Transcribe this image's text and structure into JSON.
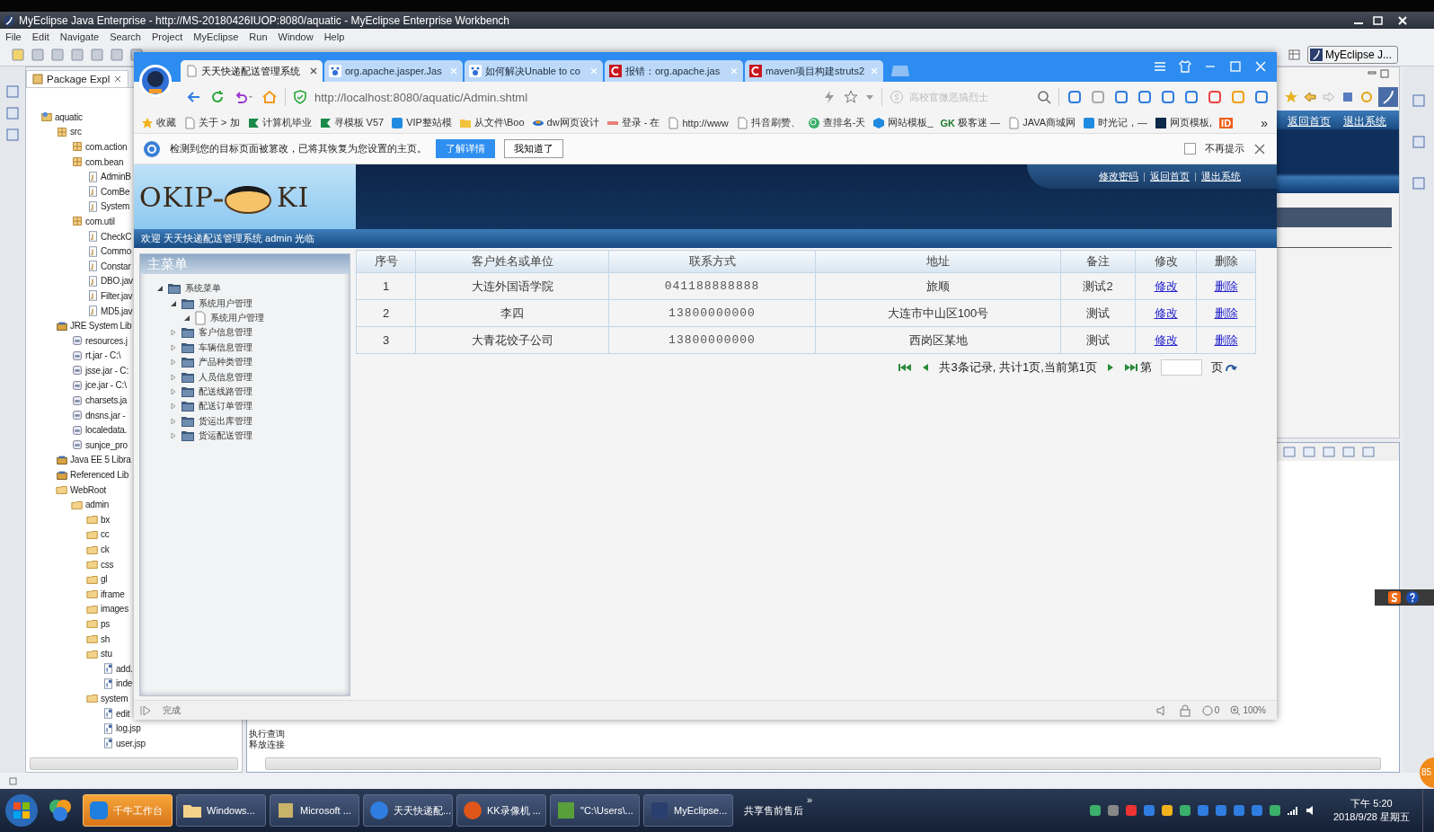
{
  "ide": {
    "title": "MyEclipse Java Enterprise - http://MS-20180426IUOP:8080/aquatic - MyEclipse Enterprise Workbench",
    "menu": [
      "File",
      "Edit",
      "Navigate",
      "Search",
      "Project",
      "MyEclipse",
      "Run",
      "Window",
      "Help"
    ],
    "perspective": "MyEclipse J...",
    "explorer": {
      "tab": "Package Expl",
      "tree": [
        {
          "label": "aquatic",
          "kind": "project",
          "children": [
            {
              "label": "src",
              "kind": "src",
              "children": [
                {
                  "label": "com.action",
                  "kind": "package"
                },
                {
                  "label": "com.bean",
                  "kind": "package",
                  "children": [
                    {
                      "label": "AdminB",
                      "kind": "java"
                    },
                    {
                      "label": "ComBe",
                      "kind": "java"
                    },
                    {
                      "label": "System",
                      "kind": "java"
                    }
                  ]
                },
                {
                  "label": "com.util",
                  "kind": "package",
                  "children": [
                    {
                      "label": "CheckC",
                      "kind": "java"
                    },
                    {
                      "label": "Commo",
                      "kind": "java"
                    },
                    {
                      "label": "Constar",
                      "kind": "java"
                    },
                    {
                      "label": "DBO.jav",
                      "kind": "java"
                    },
                    {
                      "label": "Filter.jav",
                      "kind": "java"
                    },
                    {
                      "label": "MD5.jav",
                      "kind": "java"
                    }
                  ]
                }
              ]
            },
            {
              "label": "JRE System Lib",
              "kind": "lib",
              "children": [
                {
                  "label": "resources.j",
                  "kind": "jar"
                },
                {
                  "label": "rt.jar - C:\\",
                  "kind": "jar"
                },
                {
                  "label": "jsse.jar - C:",
                  "kind": "jar"
                },
                {
                  "label": "jce.jar - C:\\",
                  "kind": "jar"
                },
                {
                  "label": "charsets.ja",
                  "kind": "jar"
                },
                {
                  "label": "dnsns.jar -",
                  "kind": "jar"
                },
                {
                  "label": "localedata.",
                  "kind": "jar"
                },
                {
                  "label": "sunjce_pro",
                  "kind": "jar"
                }
              ]
            },
            {
              "label": "Java EE 5 Libra",
              "kind": "lib"
            },
            {
              "label": "Referenced Lib",
              "kind": "lib"
            },
            {
              "label": "WebRoot",
              "kind": "folder",
              "children": [
                {
                  "label": "admin",
                  "kind": "folder",
                  "children": [
                    {
                      "label": "bx",
                      "kind": "folder"
                    },
                    {
                      "label": "cc",
                      "kind": "folder"
                    },
                    {
                      "label": "ck",
                      "kind": "folder"
                    },
                    {
                      "label": "css",
                      "kind": "folder"
                    },
                    {
                      "label": "gl",
                      "kind": "folder"
                    },
                    {
                      "label": "iframe",
                      "kind": "folder"
                    },
                    {
                      "label": "images",
                      "kind": "folder"
                    },
                    {
                      "label": "ps",
                      "kind": "folder"
                    },
                    {
                      "label": "sh",
                      "kind": "folder"
                    },
                    {
                      "label": "stu",
                      "kind": "folder",
                      "children": [
                        {
                          "label": "add.",
                          "kind": "jsp"
                        },
                        {
                          "label": "inde",
                          "kind": "jsp"
                        }
                      ]
                    },
                    {
                      "label": "system",
                      "kind": "folder",
                      "children": [
                        {
                          "label": "edit",
                          "kind": "jsp"
                        },
                        {
                          "label": "log.jsp",
                          "kind": "jsp"
                        },
                        {
                          "label": "user.jsp",
                          "kind": "jsp"
                        }
                      ]
                    }
                  ]
                }
              ]
            }
          ]
        }
      ]
    },
    "web_links": [
      "返回首页",
      "退出系统"
    ],
    "console_lines": [
      "执行查询",
      "释放连接"
    ],
    "floating_badge": "85"
  },
  "browser": {
    "tabs": [
      {
        "title": "天天快递配送管理系统",
        "kind": "page",
        "selected": true
      },
      {
        "title": "org.apache.jasper.Jas",
        "kind": "paw",
        "selected": false
      },
      {
        "title": "如何解决Unable to co",
        "kind": "paw",
        "selected": false
      },
      {
        "title": "报错：org.apache.jas",
        "kind": "c",
        "selected": false
      },
      {
        "title": "maven项目构建struts2",
        "kind": "c",
        "selected": false
      }
    ],
    "url": "http://localhost:8080/aquatic/Admin.shtml",
    "search_placeholder": "高校官微恶搞烈士",
    "bookmarks": [
      {
        "label": "收藏",
        "kind": "star"
      },
      {
        "label": "关于 > 加",
        "kind": "page"
      },
      {
        "label": "计算机毕业",
        "kind": "flag"
      },
      {
        "label": "寻模板 V57",
        "kind": "flag"
      },
      {
        "label": "VIP整站模",
        "kind": "tile"
      },
      {
        "label": "从文件\\Boo",
        "kind": "folder"
      },
      {
        "label": "dw网页设计",
        "kind": "swirl"
      },
      {
        "label": "登录 - 在",
        "kind": "red"
      },
      {
        "label": "http://www",
        "kind": "page"
      },
      {
        "label": "抖音刷赞、",
        "kind": "page"
      },
      {
        "label": "查排名-天",
        "kind": "globe"
      },
      {
        "label": "网站模板_",
        "kind": "hex"
      },
      {
        "label": "极客迷 —",
        "kind": "badge",
        "badge": "GK"
      },
      {
        "label": "JAVA商城网",
        "kind": "page"
      },
      {
        "label": "时光记，—",
        "kind": "tile"
      },
      {
        "label": "网页模板,",
        "kind": "dark"
      },
      {
        "kind": "badge",
        "badge": "ID"
      }
    ],
    "more": "»",
    "notice": {
      "text": "检测到您的目标页面被篡改，已将其恢复为您设置的主页。",
      "buttons": [
        "了解详情",
        "我知道了"
      ],
      "dont_show": {
        "label": "不再提示",
        "checked": false
      }
    },
    "page": {
      "logo": {
        "left": "OKIP",
        "right": "KI"
      },
      "top_links": [
        "修改密码",
        "返回首页",
        "退出系统"
      ],
      "welcome": "欢迎 天天快递配送管理系统 admin 光临",
      "menu_title": "主菜单",
      "menu_tree": [
        {
          "label": "系统菜单",
          "kind": "folder",
          "expanded": true,
          "children": [
            {
              "label": "系统用户管理",
              "kind": "folder",
              "expanded": true,
              "children": [
                {
                  "label": "系统用户管理",
                  "kind": "page",
                  "expanded": true
                }
              ]
            },
            {
              "label": "客户信息管理",
              "kind": "folder",
              "expanded": false
            },
            {
              "label": "车辆信息管理",
              "kind": "folder",
              "expanded": false
            },
            {
              "label": "产品种类管理",
              "kind": "folder",
              "expanded": false
            },
            {
              "label": "人员信息管理",
              "kind": "folder",
              "expanded": false
            },
            {
              "label": "配送线路管理",
              "kind": "folder",
              "expanded": false
            },
            {
              "label": "配送订单管理",
              "kind": "folder",
              "expanded": false
            },
            {
              "label": "货运出库管理",
              "kind": "folder",
              "expanded": false
            },
            {
              "label": "货运配送管理",
              "kind": "folder",
              "expanded": false
            }
          ]
        }
      ],
      "table": {
        "columns": [
          {
            "label": "序号",
            "kind": "text"
          },
          {
            "label": "客户姓名或单位",
            "kind": "text"
          },
          {
            "label": "联系方式",
            "kind": "mono"
          },
          {
            "label": "地址",
            "kind": "text"
          },
          {
            "label": "备注",
            "kind": "text"
          },
          {
            "label": "修改",
            "kind": "link"
          },
          {
            "label": "删除",
            "kind": "link"
          }
        ],
        "rows": [
          [
            "1",
            "大连外国语学院",
            "041188888888",
            "旅顺",
            "测试2",
            "修改",
            "删除"
          ],
          [
            "2",
            "李四",
            "13800000000",
            "大连市中山区100号",
            "测试",
            "修改",
            "删除"
          ],
          [
            "3",
            "大青花饺子公司",
            "13800000000",
            "西岗区某地",
            "测试",
            "修改",
            "删除"
          ]
        ]
      },
      "pager": {
        "summary": "共3条记录, 共计1页,当前第1页",
        "prefix": "第",
        "suffix": "页"
      }
    },
    "status": {
      "text": "完成",
      "count": "0",
      "zoom": "100%"
    }
  },
  "taskbar": {
    "items": [
      {
        "label": "千牛工作台",
        "kind": "qianniu",
        "flashing": true
      },
      {
        "label": "Windows...",
        "kind": "folder",
        "flashing": false
      },
      {
        "label": "Microsoft ...",
        "kind": "tool",
        "flashing": false
      },
      {
        "label": "天天快递配...",
        "kind": "browser",
        "flashing": false
      },
      {
        "label": "KK录像机 ...",
        "kind": "kk",
        "flashing": false
      },
      {
        "label": "\"C:\\Users\\...",
        "kind": "chart",
        "flashing": false
      },
      {
        "label": "MyEclipse...",
        "kind": "eclipse",
        "flashing": false
      }
    ],
    "toolbar_label": "共享售前售后",
    "toolbar_more": "»",
    "time": "下午 5:20",
    "date": "2018/9/28 星期五"
  }
}
